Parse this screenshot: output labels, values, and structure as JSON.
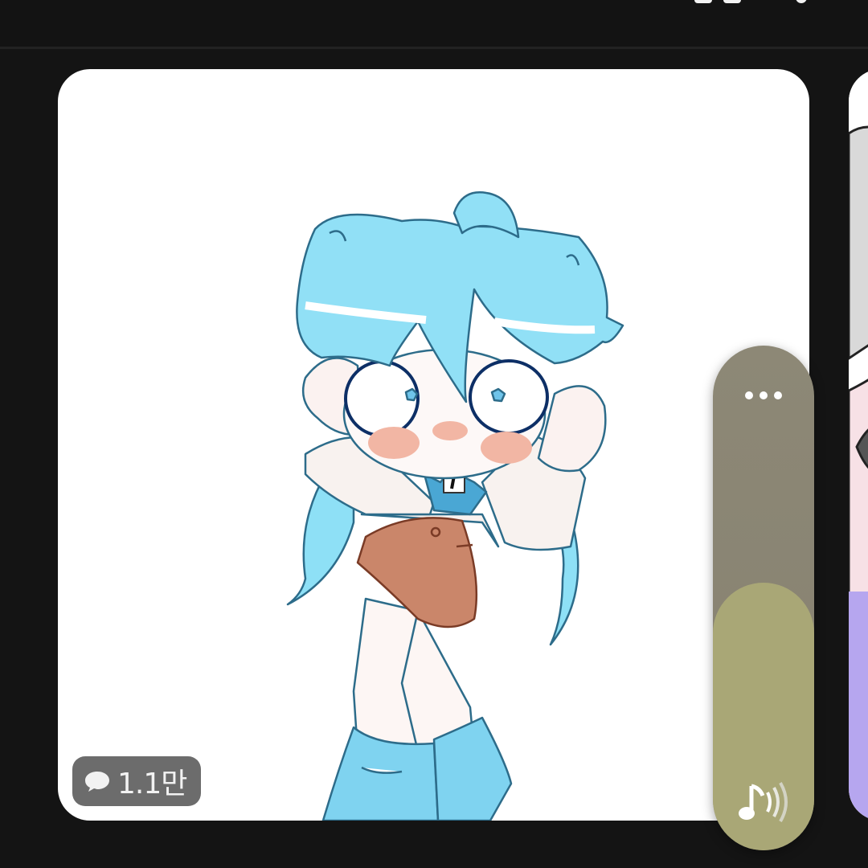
{
  "status_bar": {
    "icons": [
      "status-icon",
      "status-icon"
    ]
  },
  "post": {
    "artwork_icon": "chibi-character-illustration",
    "comment_icon": "speech-bubble-icon",
    "comment_count": "1.1만"
  },
  "next_post": {
    "artwork_icon": "partial-illustration"
  },
  "volume": {
    "more_icon": "more-dots-icon",
    "sound_icon": "music-note-sound-icon",
    "level_fraction": 0.53,
    "fill_color": "#a9a776",
    "track_color": "#8a8572"
  }
}
